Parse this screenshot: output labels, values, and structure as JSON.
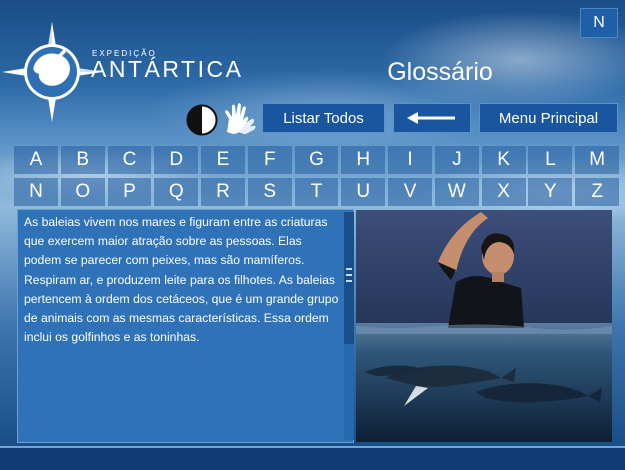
{
  "header": {
    "logo_subtitle": "EXPEDIÇÃO",
    "logo_title": "ANTÁRTICA",
    "page_title": "Glossário",
    "n_button": "N"
  },
  "toolbar": {
    "list_all_label": "Listar Todos",
    "back_icon": "left-arrow-icon",
    "main_menu_label": "Menu Principal",
    "contrast_icon": "contrast-icon",
    "sign_language_icon": "sign-language-icon"
  },
  "alphabet": {
    "row1": [
      "A",
      "B",
      "C",
      "D",
      "E",
      "F",
      "G",
      "H",
      "I",
      "J",
      "K",
      "L",
      "M"
    ],
    "row2": [
      "N",
      "O",
      "P",
      "Q",
      "R",
      "S",
      "T",
      "U",
      "V",
      "W",
      "X",
      "Y",
      "Z"
    ]
  },
  "content": {
    "text": "As baleias vivem nos mares e figuram entre as criaturas que exercem maior atração sobre as pessoas. Elas podem se parecer com peixes, mas são mamíferos. Respiram ar, e produzem leite para os filhotes. As baleias pertencem à ordem dos cetáceos, que é um grande grupo de animais com as mesmas características. Essa ordem inclui os golfinhos e as toninhas."
  },
  "colors": {
    "button_blue": "#1a56a0",
    "panel_blue": "#2f72b8",
    "text_white": "#ffffff"
  }
}
